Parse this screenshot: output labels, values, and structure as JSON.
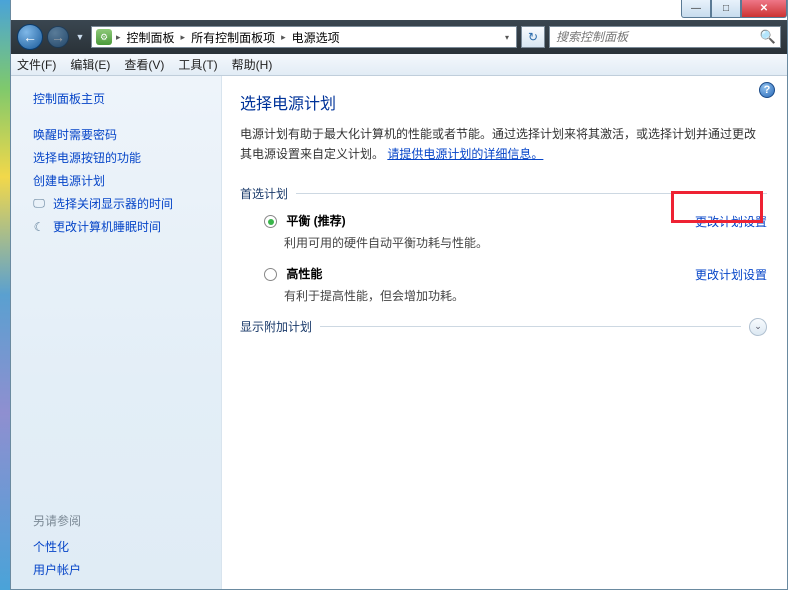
{
  "window_controls": {
    "min": "—",
    "max": "□",
    "close": "✕"
  },
  "nav": {
    "back_glyph": "←",
    "fwd_glyph": "→"
  },
  "breadcrumb": {
    "sep": "▸",
    "dd": "▾",
    "items": [
      "控制面板",
      "所有控制面板项",
      "电源选项"
    ]
  },
  "refresh_glyph": "↻",
  "search": {
    "placeholder": "搜索控制面板",
    "icon": "🔍"
  },
  "menubar": [
    "文件(F)",
    "编辑(E)",
    "查看(V)",
    "工具(T)",
    "帮助(H)"
  ],
  "sidebar": {
    "home": "控制面板主页",
    "links": [
      {
        "label": "唤醒时需要密码",
        "icon": ""
      },
      {
        "label": "选择电源按钮的功能",
        "icon": ""
      },
      {
        "label": "创建电源计划",
        "icon": ""
      },
      {
        "label": "选择关闭显示器的时间",
        "icon": "🖵"
      },
      {
        "label": "更改计算机睡眠时间",
        "icon": "☾"
      }
    ],
    "see_also_hdr": "另请参阅",
    "see_also": [
      "个性化",
      "用户帐户"
    ]
  },
  "help_glyph": "?",
  "page": {
    "title": "选择电源计划",
    "intro_a": "电源计划有助于最大化计算机的性能或者节能。通过选择计划来将其激活，或选择计划并通过更改其电源设置来自定义计划。",
    "intro_link": "请提供电源计划的详细信息。"
  },
  "sections": {
    "preferred": "首选计划",
    "additional": "显示附加计划",
    "expand_glyph": "⌄"
  },
  "plans": [
    {
      "name": "平衡 (推荐)",
      "desc": "利用可用的硬件自动平衡功耗与性能。",
      "checked": true,
      "change": "更改计划设置"
    },
    {
      "name": "高性能",
      "desc": "有利于提高性能，但会增加功耗。",
      "checked": false,
      "change": "更改计划设置"
    }
  ]
}
